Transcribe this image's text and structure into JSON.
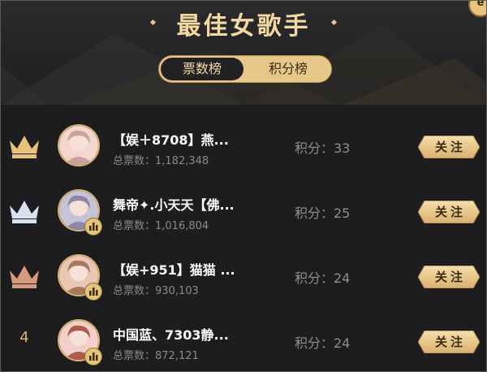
{
  "header": {
    "title": "最佳女歌手",
    "corner_badge": "e"
  },
  "tabs": [
    {
      "label": "票数榜",
      "active": true
    },
    {
      "label": "积分榜",
      "active": false
    }
  ],
  "singers": [
    {
      "rank": "1",
      "crown": "gold",
      "name": "【娱＋8708】燕...",
      "votes": "总票数：1,182,348",
      "score": "积分：33",
      "follow": "关注"
    },
    {
      "rank": "2",
      "crown": "silver",
      "name": "舞帝✦.小天天【佛...",
      "votes": "总票数：1,016,804",
      "score": "积分：25",
      "follow": "关注"
    },
    {
      "rank": "3",
      "crown": "bronze",
      "name": "【娱+951】猫猫 ...",
      "votes": "总票数：930,103",
      "score": "积分：24",
      "follow": "关注"
    },
    {
      "rank": "4",
      "crown": "",
      "name": "中国蓝、7303静...",
      "votes": "总票数：872,121",
      "score": "积分：24",
      "follow": "关注"
    }
  ],
  "colors": {
    "gold": "#e8c27a",
    "silver": "#d7e2f0",
    "bronze": "#d79a7a",
    "accent": "#f3d9a2"
  }
}
